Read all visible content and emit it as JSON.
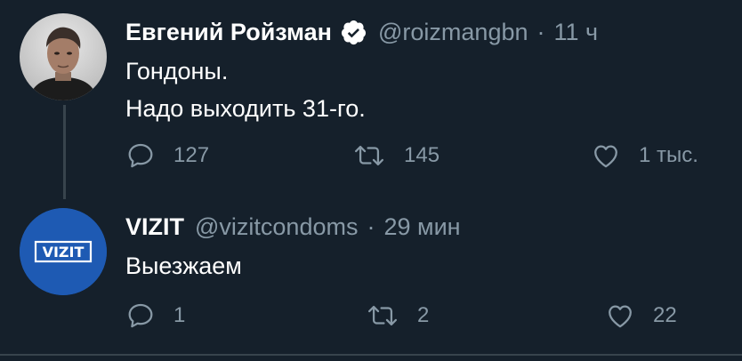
{
  "tweets": [
    {
      "name": "Евгений Ройзман",
      "handle": "@roizmangbn",
      "separator": "·",
      "time": "11 ч",
      "text_lines": [
        "Гондоны.",
        "Надо выходить 31-го."
      ],
      "replies": "127",
      "retweets": "145",
      "likes": "1 тыс."
    },
    {
      "name": "VIZIT",
      "handle": "@vizitcondoms",
      "separator": "·",
      "time": "29 мин",
      "avatar_logo": "VIZIT",
      "text_lines": [
        "Выезжаем"
      ],
      "replies": "1",
      "retweets": "2",
      "likes": "22"
    }
  ],
  "icons": [
    "verified-badge-icon",
    "reply-icon",
    "retweet-icon",
    "like-icon"
  ],
  "colors": {
    "background": "#15202b",
    "secondary_text": "#8899a6",
    "divider": "#38444d",
    "vizit_blue": "#1e5ab3"
  }
}
